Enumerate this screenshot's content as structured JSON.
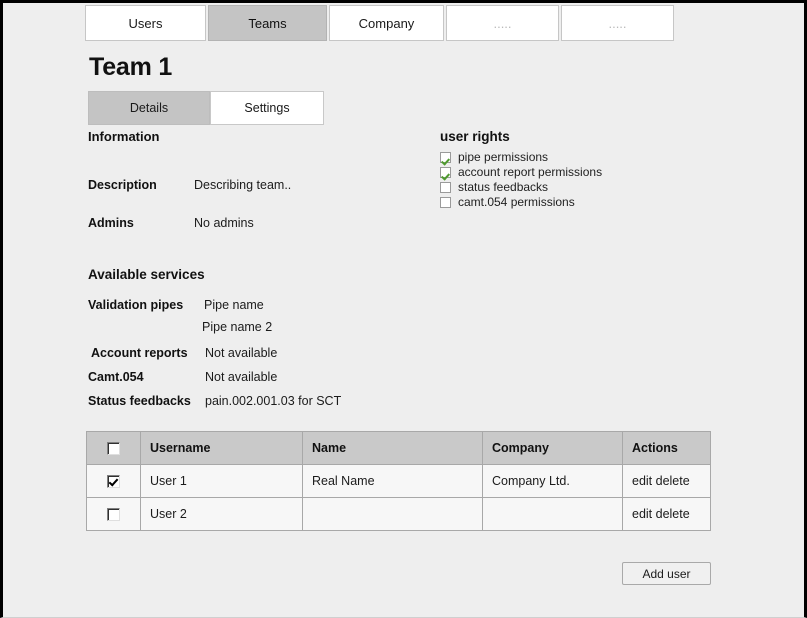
{
  "nav": {
    "tabs": [
      {
        "label": "Users",
        "active": false
      },
      {
        "label": "Teams",
        "active": true
      },
      {
        "label": "Company",
        "active": false
      },
      {
        "label": ".....",
        "active": false
      },
      {
        "label": ".....",
        "active": false
      }
    ]
  },
  "page": {
    "title": "Team 1"
  },
  "subtabs": [
    {
      "label": "Details",
      "active": true
    },
    {
      "label": "Settings",
      "active": false
    }
  ],
  "information": {
    "heading": "Information",
    "description_label": "Description",
    "description_value": "Describing team..",
    "admins_label": "Admins",
    "admins_value": "No admins"
  },
  "user_rights": {
    "heading": "user rights",
    "checked_color": "#4f9a2f",
    "items": [
      {
        "label": "pipe permissions",
        "checked": true
      },
      {
        "label": "account report permissions",
        "checked": true
      },
      {
        "label": "status feedbacks",
        "checked": false
      },
      {
        "label": "camt.054 permissions",
        "checked": false
      }
    ]
  },
  "available_services": {
    "heading": "Available services",
    "validation_pipes_label": "Validation pipes",
    "validation_pipes_value_1": "Pipe name",
    "validation_pipes_value_2": "Pipe name 2",
    "account_reports_label": "Account reports",
    "account_reports_value": "Not available",
    "camt054_label": "Camt.054",
    "camt054_value": "Not available",
    "status_feedbacks_label": "Status feedbacks",
    "status_feedbacks_value": "pain.002.001.03 for SCT"
  },
  "users_table": {
    "columns": [
      "",
      "Username",
      "Name",
      "Company",
      "Actions"
    ],
    "header_select_all_checked": false,
    "rows": [
      {
        "selected": true,
        "username": "User 1",
        "name": "Real Name",
        "company": "Company Ltd.",
        "actions": "edit delete"
      },
      {
        "selected": false,
        "username": "User 2",
        "name": "",
        "company": "",
        "actions": "edit delete"
      }
    ]
  },
  "footer": {
    "add_user_label": "Add user"
  }
}
